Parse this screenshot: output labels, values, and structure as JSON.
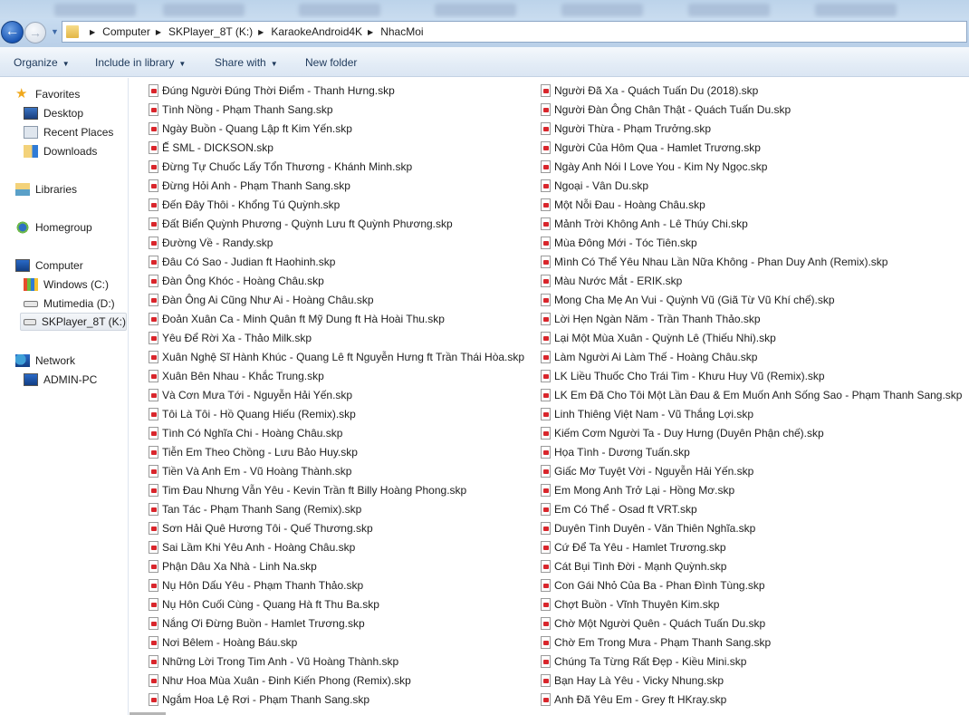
{
  "address": {
    "breadcrumbs": [
      "Computer",
      "SKPlayer_8T (K:)",
      "KaraokeAndroid4K",
      "NhacMoi"
    ]
  },
  "toolbar": {
    "organize": "Organize",
    "include_in_library": "Include in library",
    "share_with": "Share with",
    "new_folder": "New folder"
  },
  "sidebar": {
    "favorites": "Favorites",
    "desktop": "Desktop",
    "recent_places": "Recent Places",
    "downloads": "Downloads",
    "libraries": "Libraries",
    "homegroup": "Homegroup",
    "computer": "Computer",
    "drive_c": "Windows (C:)",
    "drive_d": "Mutimedia (D:)",
    "drive_k": "SKPlayer_8T (K:)",
    "network": "Network",
    "admin_pc": "ADMIN-PC"
  },
  "files": {
    "column1": [
      "Đúng Người Đúng Thời Điểm - Thanh Hưng.skp",
      "Tình Nồng - Phạm Thanh Sang.skp",
      "Ngày Buồn - Quang Lập ft Kim Yến.skp",
      "Ế SML - DICKSON.skp",
      "Đừng Tự Chuốc Lấy Tổn Thương - Khánh Minh.skp",
      "Đừng Hỏi Anh - Phạm Thanh Sang.skp",
      "Đến Đây Thôi - Khổng Tú Quỳnh.skp",
      "Đất Biển Quỳnh Phương - Quỳnh Lưu ft Quỳnh Phương.skp",
      "Đường Về - Randy.skp",
      "Đâu Có Sao - Judian ft Haohinh.skp",
      "Đàn Ông Khóc - Hoàng Châu.skp",
      "Đàn Ông Ai Cũng Như Ai - Hoàng Châu.skp",
      "Đoản Xuân Ca - Minh Quân ft Mỹ Dung ft Hà Hoài Thu.skp",
      "Yêu Để Rời Xa - Thảo Milk.skp",
      "Xuân Nghệ Sĩ Hành Khúc - Quang Lê ft Nguyễn Hưng ft Trần Thái Hòa.skp",
      "Xuân Bên Nhau - Khắc Trung.skp",
      "Và Cơn Mưa Tới - Nguyễn Hải Yến.skp",
      "Tôi Là Tôi - Hồ Quang Hiếu (Remix).skp",
      "Tình Có Nghĩa Chi - Hoàng Châu.skp",
      "Tiễn Em Theo Chồng - Lưu Bảo Huy.skp",
      "Tiền Và Anh Em - Vũ Hoàng Thành.skp",
      "Tim Đau Nhưng Vẫn Yêu - Kevin Trần ft Billy Hoàng Phong.skp",
      "Tan Tác - Phạm Thanh Sang (Remix).skp",
      "Sơn Hải Quê Hương Tôi - Quế Thương.skp",
      "Sai Lầm Khi Yêu Anh - Hoàng Châu.skp",
      "Phận Dâu Xa Nhà - Linh Na.skp",
      "Nụ Hôn Dấu Yêu - Phạm Thanh Thảo.skp",
      "Nụ Hôn Cuối Cùng - Quang Hà ft Thu Ba.skp",
      "Nắng Ơi Đừng Buồn - Hamlet Trương.skp",
      "Nơi Bêlem - Hoàng Báu.skp",
      "Những Lời Trong Tim Anh - Vũ Hoàng Thành.skp",
      "Như Hoa Mùa Xuân - Đinh Kiến Phong (Remix).skp",
      "Ngắm Hoa Lệ Rơi - Phạm Thanh Sang.skp"
    ],
    "column2": [
      "Người Đã Xa - Quách Tuấn Du (2018).skp",
      "Người Đàn Ông Chân Thật - Quách Tuấn Du.skp",
      "Người Thừa - Phạm Trưởng.skp",
      "Người Của Hôm Qua - Hamlet Trương.skp",
      "Ngày Anh Nói I Love You - Kim Ny Ngọc.skp",
      "Ngoại - Vân Du.skp",
      "Một Nỗi Đau - Hoàng Châu.skp",
      "Mảnh Trời Không Anh - Lê Thúy Chi.skp",
      "Mùa Đông Mới - Tóc Tiên.skp",
      "Mình Có Thể Yêu Nhau Lần Nữa Không - Phan Duy Anh (Remix).skp",
      "Màu Nước Mắt - ERIK.skp",
      "Mong Cha Mẹ An Vui - Quỳnh Vũ (Giã Từ Vũ Khí chế).skp",
      "Lời Hẹn Ngàn Năm - Trần Thanh Thảo.skp",
      "Lại Một Mùa Xuân - Quỳnh Lê (Thiếu Nhi).skp",
      "Làm Người Ai Làm Thế - Hoàng Châu.skp",
      "LK Liều Thuốc Cho Trái Tim - Khưu Huy Vũ (Remix).skp",
      "LK Em Đã Cho Tôi Một Lần Đau & Em Muốn Anh Sống Sao - Phạm Thanh Sang.skp",
      "Linh Thiêng Việt Nam - Vũ Thắng Lợi.skp",
      "Kiếm Cơm Người Ta - Duy Hưng (Duyên Phận chế).skp",
      "Họa Tình - Dương Tuấn.skp",
      "Giấc Mơ Tuyệt Vời - Nguyễn Hải Yến.skp",
      "Em Mong Anh Trở Lại - Hồng Mơ.skp",
      "Em Có Thể - Osad ft VRT.skp",
      "Duyên Tình Duyên - Văn Thiên Nghĩa.skp",
      "Cứ Để Ta Yêu - Hamlet Trương.skp",
      "Cát Bụi Tình Đời - Mạnh Quỳnh.skp",
      "Con Gái Nhỏ Của Ba - Phan Đình Tùng.skp",
      "Chợt Buồn - Vĩnh Thuyên Kim.skp",
      "Chờ Một Người Quên - Quách Tuấn Du.skp",
      "Chờ Em Trong Mưa - Phạm Thanh Sang.skp",
      "Chúng Ta Từng Rất Đẹp - Kiều Mini.skp",
      "Bạn Hay Là Yêu - Vicky Nhung.skp",
      "Anh Đã Yêu Em - Grey ft HKray.skp"
    ]
  }
}
